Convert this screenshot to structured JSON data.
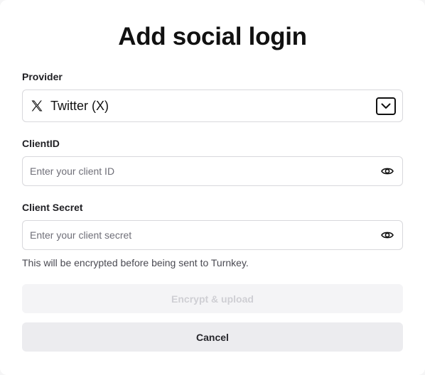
{
  "dialog": {
    "title": "Add social login"
  },
  "provider": {
    "label": "Provider",
    "selected": "Twitter (X)",
    "icon": "x-logo-icon"
  },
  "client_id": {
    "label": "ClientID",
    "value": "",
    "placeholder": "Enter your client ID",
    "icon": "eye-icon"
  },
  "client_secret": {
    "label": "Client Secret",
    "value": "",
    "placeholder": "Enter your client secret",
    "icon": "eye-icon",
    "helper": "This will be encrypted before being sent to Turnkey."
  },
  "actions": {
    "primary_label": "Encrypt & upload",
    "primary_disabled": true,
    "secondary_label": "Cancel"
  }
}
